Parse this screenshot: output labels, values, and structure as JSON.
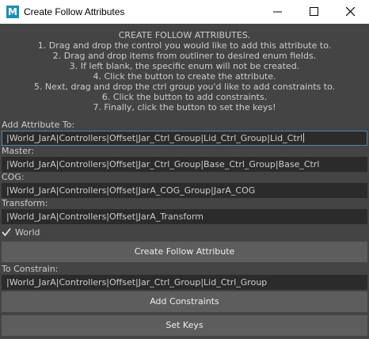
{
  "window": {
    "icon_letter": "M",
    "title": "Create Follow Attributes",
    "controls": [
      "minimize-icon",
      "maximize-icon",
      "close-icon"
    ]
  },
  "instructions": [
    "CREATE FOLLOW ATTRIBUTES.",
    "1. Drag and drop the control you would like to add this attribute to.",
    "2. Drag and drop items from outliner to desired enum fields.",
    "3. If left blank, the specific enum will not be created.",
    "4. Click the button to create the attribute.",
    "5. Next, drag and drop the ctrl group you'd like to add constraints to.",
    "6. Click the button to add constraints.",
    "7. Finally, click the button to set the keys!"
  ],
  "fields": {
    "add_attribute_to": {
      "label": "Add Attribute To:",
      "value": "|World_JarA|Controllers|Offset|Jar_Ctrl_Group|Lid_Ctrl_Group|Lid_Ctrl"
    },
    "master": {
      "label": "Master:",
      "value": "|World_JarA|Controllers|Offset|Jar_Ctrl_Group|Base_Ctrl_Group|Base_Ctrl"
    },
    "cog": {
      "label": "COG:",
      "value": "|World_JarA|Controllers|Offset|JarA_COG_Group|JarA_COG"
    },
    "transform": {
      "label": "Transform:",
      "value": "|World_JarA|Controllers|Offset|JarA_Transform"
    },
    "to_constrain": {
      "label": "To Constrain:",
      "value": "|World_JarA|Controllers|Offset|Jar_Ctrl_Group|Lid_Ctrl_Group"
    }
  },
  "world_checkbox": {
    "label": "World",
    "checked": true
  },
  "buttons": {
    "create_follow_attribute": "Create Follow Attribute",
    "add_constraints": "Add Constraints",
    "set_keys": "Set Keys"
  },
  "colors": {
    "background": "#444444",
    "field_background": "#2b2b2b",
    "button_background": "#5d5d5d",
    "focus_border": "#5285a6"
  }
}
